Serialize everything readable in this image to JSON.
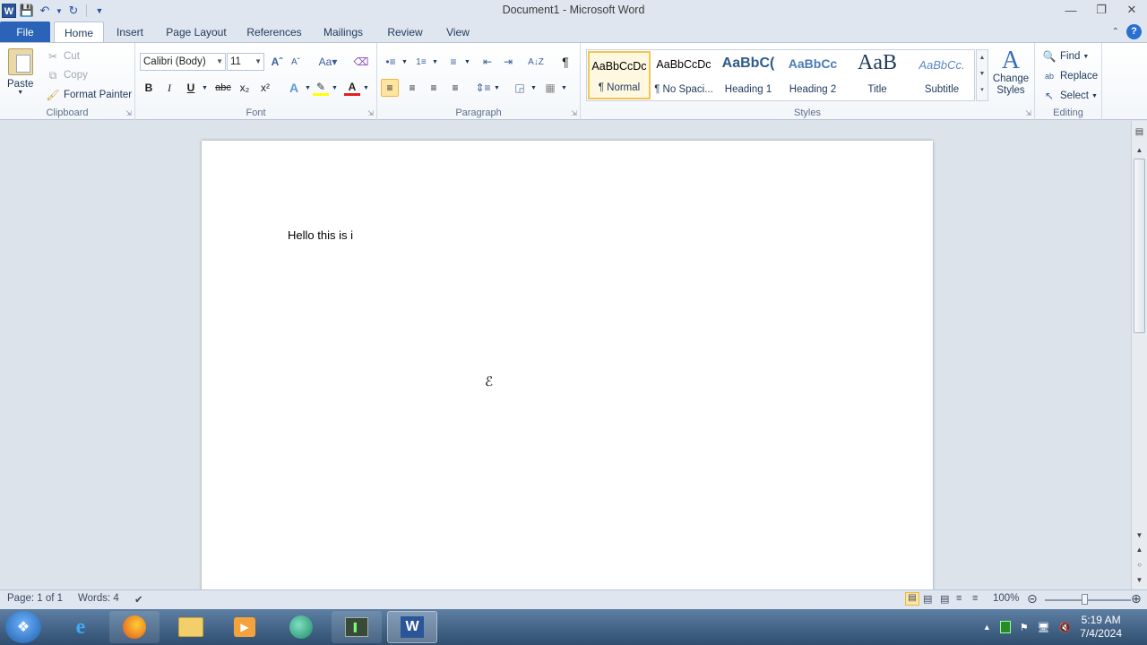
{
  "window": {
    "title": "Document1  -  Microsoft Word",
    "logo_letter": "W"
  },
  "tabs": [
    "File",
    "Home",
    "Insert",
    "Page Layout",
    "References",
    "Mailings",
    "Review",
    "View"
  ],
  "clipboard": {
    "paste": "Paste",
    "cut": "Cut",
    "copy": "Copy",
    "format_painter": "Format Painter",
    "label": "Clipboard"
  },
  "font": {
    "family": "Calibri (Body)",
    "size": "11",
    "label": "Font"
  },
  "paragraph": {
    "label": "Paragraph"
  },
  "styles": {
    "label": "Styles",
    "items": [
      {
        "sample": "AaBbCcDc",
        "name": "¶ Normal"
      },
      {
        "sample": "AaBbCcDc",
        "name": "¶ No Spaci..."
      },
      {
        "sample": "AaBbC(",
        "name": "Heading 1"
      },
      {
        "sample": "AaBbCc",
        "name": "Heading 2"
      },
      {
        "sample": "AaB",
        "name": "Title"
      },
      {
        "sample": "AaBbCc.",
        "name": "Subtitle"
      }
    ],
    "change_styles": "Change Styles"
  },
  "editing": {
    "label": "Editing",
    "find": "Find",
    "replace": "Replace",
    "select": "Select"
  },
  "document": {
    "text": "Hello this is i"
  },
  "status": {
    "page": "Page: 1 of 1",
    "words": "Words: 4",
    "zoom": "100%"
  },
  "clock": {
    "time": "5:19 AM",
    "date": "7/4/2024"
  }
}
